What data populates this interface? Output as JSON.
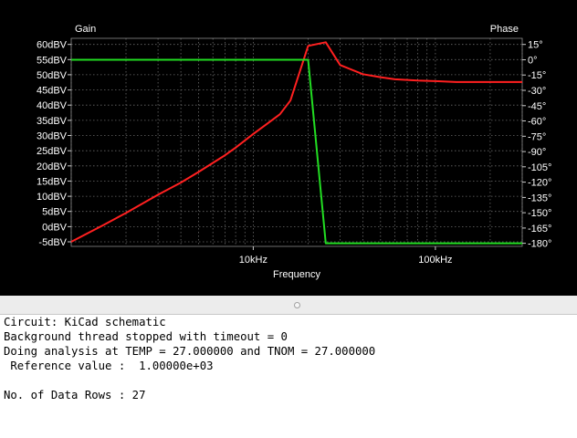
{
  "chart_data": {
    "type": "line",
    "title": "",
    "xlabel": "Frequency",
    "x_scale": "log",
    "xlim": [
      1000,
      300000
    ],
    "x_tick_labels": [
      "10kHz",
      "100kHz"
    ],
    "y_left_label": "Gain",
    "y_left_ticks": [
      "60dBV",
      "55dBV",
      "50dBV",
      "45dBV",
      "40dBV",
      "35dBV",
      "30dBV",
      "25dBV",
      "20dBV",
      "15dBV",
      "10dBV",
      "5dBV",
      "0dBV",
      "-5dBV"
    ],
    "y_left_values": [
      60,
      55,
      50,
      45,
      40,
      35,
      30,
      25,
      20,
      15,
      10,
      5,
      0,
      -5
    ],
    "ylim_left": [
      -6.5,
      62
    ],
    "y_right_label": "Phase",
    "y_right_ticks": [
      "15°",
      "0°",
      "-15°",
      "-30°",
      "-45°",
      "-60°",
      "-75°",
      "-90°",
      "-105°",
      "-120°",
      "-135°",
      "-150°",
      "-165°",
      "-180°"
    ],
    "y_right_values": [
      15,
      0,
      -15,
      -30,
      -45,
      -60,
      -75,
      -90,
      -105,
      -120,
      -135,
      -150,
      -165,
      -180
    ],
    "ylim_right": [
      -183,
      21
    ],
    "grid": true,
    "series": [
      {
        "axis": "left",
        "color": "#ff2020",
        "x": [
          1000,
          1500,
          2000,
          3000,
          4000,
          5000,
          6000,
          7000,
          8000,
          10000,
          12000,
          14000,
          16000,
          20000,
          25000,
          30000,
          40000,
          50000,
          60000,
          80000,
          100000,
          130000,
          200000,
          300000
        ],
        "values": [
          -5,
          0.5,
          4.5,
          10.5,
          14.5,
          18,
          21,
          23.5,
          26,
          30.5,
          34,
          37,
          41.5,
          59.5,
          60.7,
          53.2,
          50.2,
          49.2,
          48.5,
          48.1,
          47.9,
          47.6,
          47.6,
          47.6
        ]
      },
      {
        "axis": "right",
        "color": "#22dd22",
        "x": [
          1000,
          20000,
          25000,
          300000
        ],
        "values": [
          0,
          0,
          -180,
          -180
        ]
      }
    ]
  },
  "console": {
    "lines": [
      "Circuit: KiCad schematic",
      "Background thread stopped with timeout = 0",
      "Doing analysis at TEMP = 27.000000 and TNOM = 27.000000",
      " Reference value :  1.00000e+03",
      "",
      "No. of Data Rows : 27"
    ]
  }
}
